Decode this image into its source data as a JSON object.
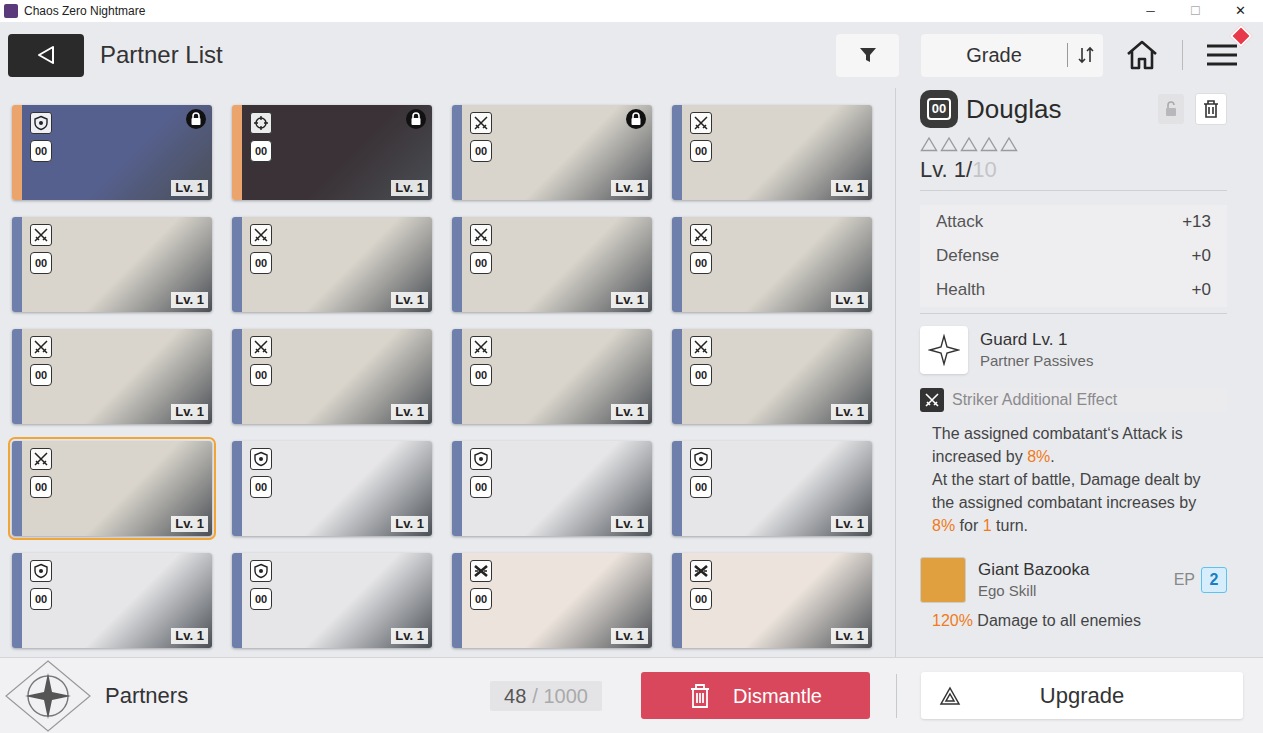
{
  "window": {
    "title": "Chaos Zero Nightmare",
    "controls": [
      "─",
      "☐",
      "✕"
    ]
  },
  "header": {
    "title": "Partner List",
    "sort_label": "Grade",
    "menu_notification": true
  },
  "partners": [
    {
      "kind": "shield",
      "grade_badge": "00",
      "level": "Lv. 1",
      "locked": true,
      "selected": false,
      "frame": "gold",
      "color": "#56608e"
    },
    {
      "kind": "target",
      "grade_badge": "00",
      "level": "Lv. 1",
      "locked": true,
      "selected": false,
      "frame": "gold",
      "color": "#3a3236"
    },
    {
      "kind": "swords",
      "grade_badge": "00",
      "level": "Lv. 1",
      "locked": true,
      "selected": false,
      "frame": "blue",
      "color": "#d9d5cc"
    },
    {
      "kind": "swords",
      "grade_badge": "00",
      "level": "Lv. 1",
      "locked": false,
      "selected": false,
      "frame": "blue",
      "color": "#d9d5cc"
    },
    {
      "kind": "swords",
      "grade_badge": "00",
      "level": "Lv. 1",
      "locked": false,
      "selected": false,
      "frame": "blue",
      "color": "#d9d5cc"
    },
    {
      "kind": "swords",
      "grade_badge": "00",
      "level": "Lv. 1",
      "locked": false,
      "selected": false,
      "frame": "blue",
      "color": "#d9d5cc"
    },
    {
      "kind": "swords",
      "grade_badge": "00",
      "level": "Lv. 1",
      "locked": false,
      "selected": false,
      "frame": "blue",
      "color": "#d9d5cc"
    },
    {
      "kind": "swords",
      "grade_badge": "00",
      "level": "Lv. 1",
      "locked": false,
      "selected": false,
      "frame": "blue",
      "color": "#d9d5cc"
    },
    {
      "kind": "swords",
      "grade_badge": "00",
      "level": "Lv. 1",
      "locked": false,
      "selected": false,
      "frame": "blue",
      "color": "#d9d5cc"
    },
    {
      "kind": "swords",
      "grade_badge": "00",
      "level": "Lv. 1",
      "locked": false,
      "selected": false,
      "frame": "blue",
      "color": "#d9d5cc"
    },
    {
      "kind": "swords",
      "grade_badge": "00",
      "level": "Lv. 1",
      "locked": false,
      "selected": false,
      "frame": "blue",
      "color": "#d9d5cc"
    },
    {
      "kind": "swords",
      "grade_badge": "00",
      "level": "Lv. 1",
      "locked": false,
      "selected": false,
      "frame": "blue",
      "color": "#d9d5cc"
    },
    {
      "kind": "swords",
      "grade_badge": "00",
      "level": "Lv. 1",
      "locked": false,
      "selected": true,
      "frame": "blue",
      "color": "#d9d5cc"
    },
    {
      "kind": "shield",
      "grade_badge": "00",
      "level": "Lv. 1",
      "locked": false,
      "selected": false,
      "frame": "blue",
      "color": "#e6e6e8"
    },
    {
      "kind": "shield",
      "grade_badge": "00",
      "level": "Lv. 1",
      "locked": false,
      "selected": false,
      "frame": "blue",
      "color": "#e6e6e8"
    },
    {
      "kind": "shield",
      "grade_badge": "00",
      "level": "Lv. 1",
      "locked": false,
      "selected": false,
      "frame": "blue",
      "color": "#e6e6e8"
    },
    {
      "kind": "shield",
      "grade_badge": "00",
      "level": "Lv. 1",
      "locked": false,
      "selected": false,
      "frame": "blue",
      "color": "#e6e6e8"
    },
    {
      "kind": "shield",
      "grade_badge": "00",
      "level": "Lv. 1",
      "locked": false,
      "selected": false,
      "frame": "blue",
      "color": "#e6e6e8"
    },
    {
      "kind": "guns",
      "grade_badge": "00",
      "level": "Lv. 1",
      "locked": false,
      "selected": false,
      "frame": "blue",
      "color": "#ece4dc"
    },
    {
      "kind": "guns",
      "grade_badge": "00",
      "level": "Lv. 1",
      "locked": false,
      "selected": false,
      "frame": "blue",
      "color": "#ece4dc"
    }
  ],
  "detail": {
    "grade_badge": "00",
    "name": "Douglas",
    "locked": false,
    "stars": 0,
    "level": "Lv. 1/",
    "max_level": "10",
    "stats": [
      {
        "label": "Attack",
        "value": "+13"
      },
      {
        "label": "Defense",
        "value": "+0"
      },
      {
        "label": "Health",
        "value": "+0"
      }
    ],
    "passive": {
      "name": "Guard Lv. 1",
      "type": "Partner Passives",
      "effect_label": "Striker Additional Effect",
      "description": [
        [
          {
            "text": "The assigned combatant‘s Attack is increased by ",
            "highlight": false
          },
          {
            "text": "8%",
            "highlight": true
          },
          {
            "text": ".",
            "highlight": false
          }
        ],
        [
          {
            "text": "At the start of battle, Damage dealt by the assigned combatant increases by ",
            "highlight": false
          },
          {
            "text": "8%",
            "highlight": true
          },
          {
            "text": " for ",
            "highlight": false
          },
          {
            "text": "1",
            "highlight": true
          },
          {
            "text": " turn.",
            "highlight": false
          }
        ]
      ]
    },
    "ego": {
      "name": "Giant Bazooka",
      "type": "Ego Skill",
      "ep_label": "EP",
      "ep": "2",
      "description": [
        {
          "text": "120%",
          "highlight": true
        },
        {
          "text": " Damage to all enemies",
          "highlight": false
        }
      ]
    }
  },
  "footer": {
    "title": "Partners",
    "count": "48",
    "capacity": "/ 1000",
    "dismantle": "Dismantle",
    "upgrade": "Upgrade"
  }
}
